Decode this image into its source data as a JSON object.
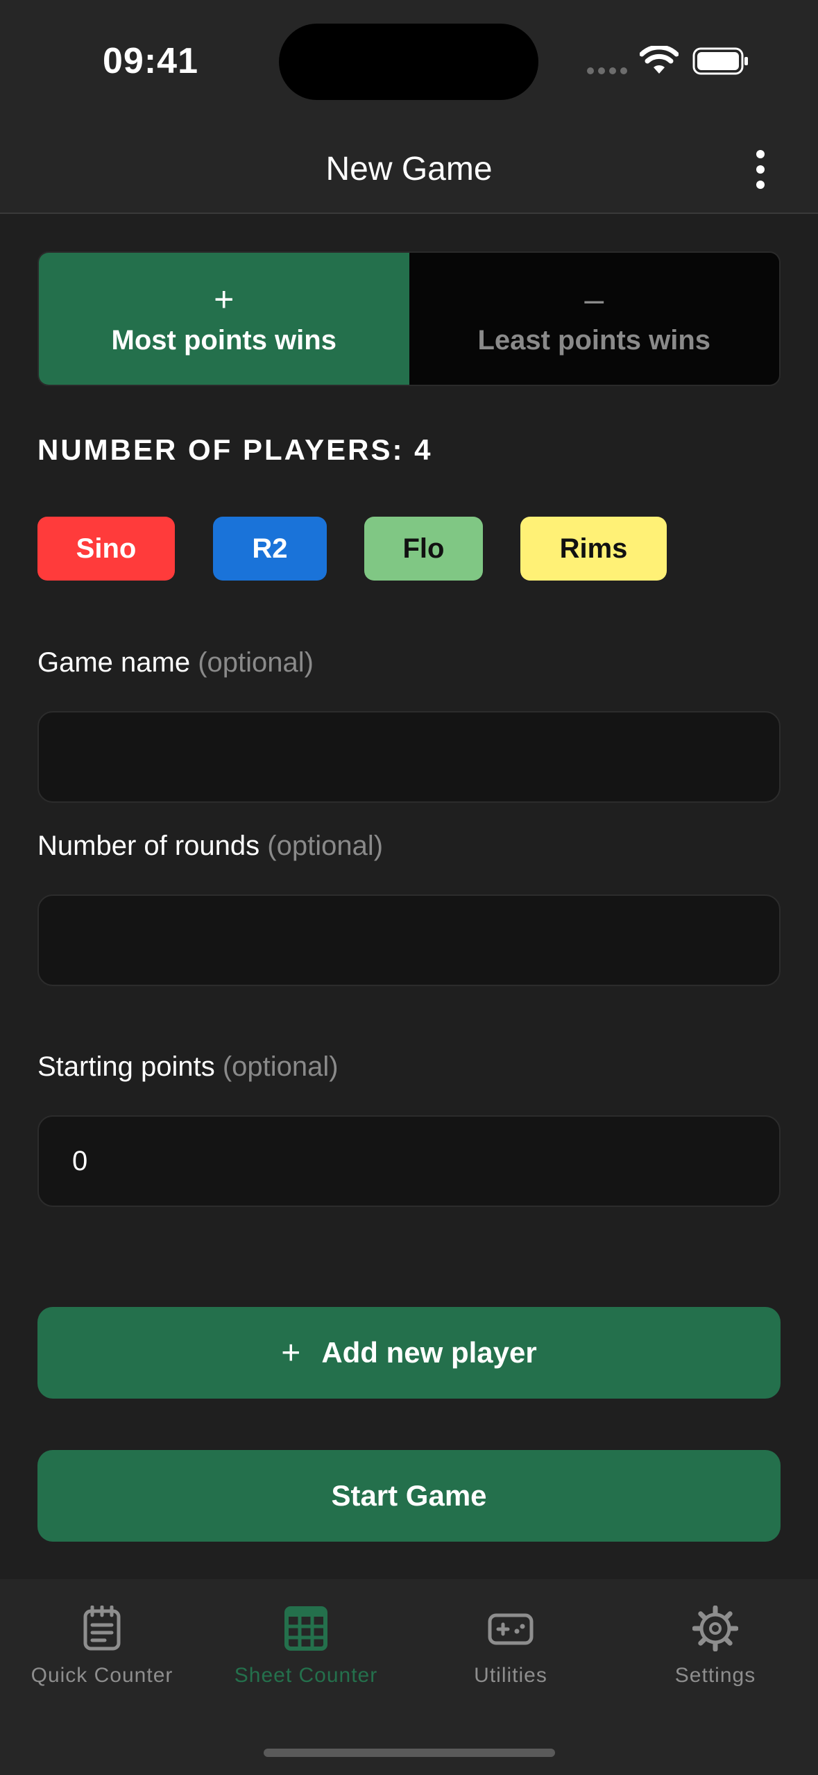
{
  "status_bar": {
    "time": "09:41"
  },
  "nav": {
    "title": "New Game",
    "more_icon": "more-vertical-icon"
  },
  "mode_toggle": {
    "options": [
      {
        "symbol": "+",
        "label": "Most points wins",
        "selected": true
      },
      {
        "symbol": "–",
        "label": "Least points wins",
        "selected": false
      }
    ]
  },
  "players": {
    "heading": "NUMBER OF PLAYERS: 4",
    "list": [
      {
        "name": "Sino",
        "bg": "#ff3b3b",
        "fg": "#ffffff"
      },
      {
        "name": "R2",
        "bg": "#1a73d9",
        "fg": "#ffffff"
      },
      {
        "name": "Flo",
        "bg": "#80c784",
        "fg": "#111111"
      },
      {
        "name": "Rims",
        "bg": "#fff176",
        "fg": "#111111"
      }
    ]
  },
  "fields": {
    "game_name": {
      "label": "Game name",
      "optional": "(optional)",
      "value": "",
      "placeholder": ""
    },
    "rounds": {
      "label": "Number of rounds",
      "optional": "(optional)",
      "value": "",
      "placeholder": ""
    },
    "starting_points": {
      "label": "Starting points",
      "optional": "(optional)",
      "value": "0",
      "placeholder": ""
    }
  },
  "buttons": {
    "add_player_symbol": "+",
    "add_player": "Add new player",
    "start": "Start Game"
  },
  "tab_bar": {
    "tabs": [
      {
        "label": "Quick Counter",
        "icon": "notepad-icon",
        "active": false
      },
      {
        "label": "Sheet Counter",
        "icon": "grid-table-icon",
        "active": true
      },
      {
        "label": "Utilities",
        "icon": "gamepad-icon",
        "active": false
      },
      {
        "label": "Settings",
        "icon": "gear-icon",
        "active": false
      }
    ]
  },
  "colors": {
    "accent": "#24704c",
    "background": "#1f1f1f",
    "bar": "#262626",
    "input": "#141414",
    "muted": "#8a8a8a"
  }
}
